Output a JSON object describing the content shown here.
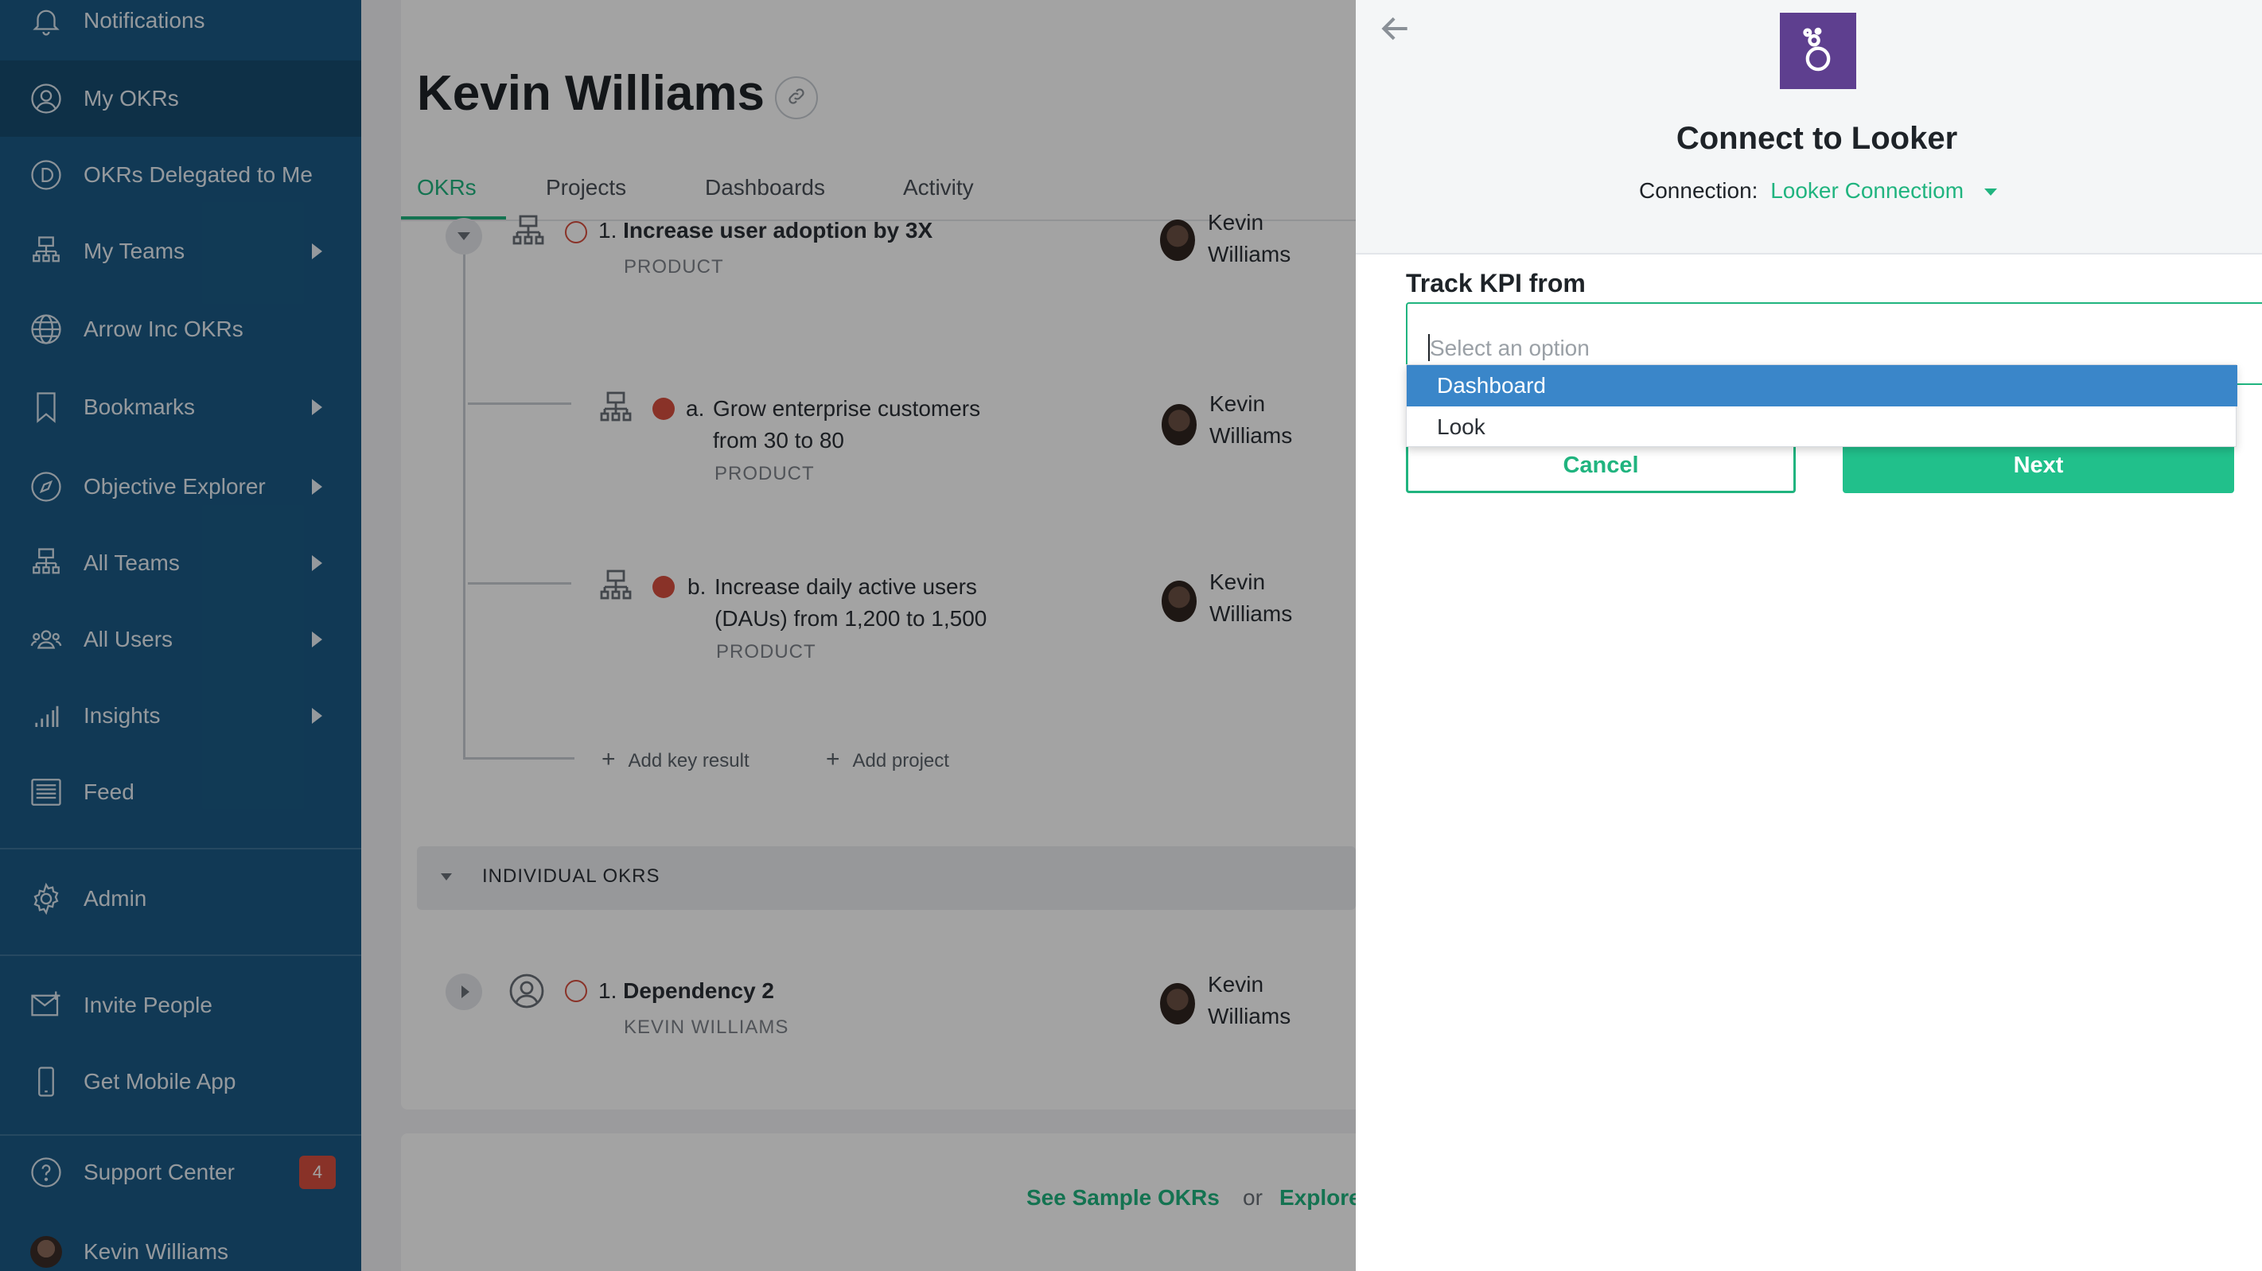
{
  "sidebar": {
    "items": [
      {
        "label": "Notifications",
        "icon": "bell-icon"
      },
      {
        "label": "My OKRs",
        "icon": "user-circle-icon"
      },
      {
        "label": "OKRs Delegated to Me",
        "icon": "delegated-icon"
      },
      {
        "label": "My Teams",
        "icon": "org-chart-icon"
      },
      {
        "label": "Arrow Inc OKRs",
        "icon": "globe-icon"
      },
      {
        "label": "Bookmarks",
        "icon": "bookmark-icon"
      },
      {
        "label": "Objective Explorer",
        "icon": "compass-icon"
      },
      {
        "label": "All Teams",
        "icon": "org-chart-icon"
      },
      {
        "label": "All Users",
        "icon": "users-icon"
      },
      {
        "label": "Insights",
        "icon": "bar-chart-icon"
      },
      {
        "label": "Feed",
        "icon": "feed-icon"
      },
      {
        "label": "Admin",
        "icon": "gear-icon"
      },
      {
        "label": "Invite People",
        "icon": "envelope-icon"
      },
      {
        "label": "Get Mobile App",
        "icon": "phone-icon"
      },
      {
        "label": "Support Center",
        "icon": "question-icon",
        "badge": "4"
      },
      {
        "label": "Kevin Williams",
        "icon": "avatar"
      }
    ]
  },
  "main": {
    "title": "Kevin Williams",
    "tabs": [
      {
        "label": "OKRs",
        "active": true
      },
      {
        "label": "Projects"
      },
      {
        "label": "Dashboards"
      },
      {
        "label": "Activity"
      }
    ],
    "objective": {
      "number": "1.",
      "title": "Increase user adoption by 3X",
      "team": "PRODUCT",
      "owner_first": "Kevin",
      "owner_last": "Williams"
    },
    "key_results": [
      {
        "letter": "a.",
        "line1": "Grow enterprise customers",
        "line2": "from 30 to 80",
        "team": "PRODUCT",
        "owner_first": "Kevin",
        "owner_last": "Williams"
      },
      {
        "letter": "b.",
        "line1": "Increase daily active users",
        "line2": "(DAUs) from 1,200 to 1,500",
        "team": "PRODUCT",
        "owner_first": "Kevin",
        "owner_last": "Williams"
      }
    ],
    "add_key_result": "Add key result",
    "add_project": "Add project",
    "section_label": "INDIVIDUAL OKRS",
    "individual": {
      "number": "1.",
      "title": "Dependency 2",
      "owner_label": "KEVIN WILLIAMS",
      "owner_first": "Kevin",
      "owner_last": "Williams"
    },
    "footer": {
      "see_sample": "See Sample OKRs",
      "or": "or",
      "explore": "Explore"
    }
  },
  "panel": {
    "title": "Connect to Looker",
    "connection_label": "Connection:",
    "connection_value": "Looker Connectiom",
    "field_label": "Track KPI from",
    "placeholder": "Select an option",
    "options": [
      "Dashboard",
      "Look"
    ],
    "cancel_label": "Cancel",
    "next_label": "Next"
  },
  "colors": {
    "sidebar": "#1b5a85",
    "accent": "#20b47f",
    "highlight": "#3a86c9",
    "logo": "#5e3f8f",
    "badge": "#d74f3f"
  }
}
